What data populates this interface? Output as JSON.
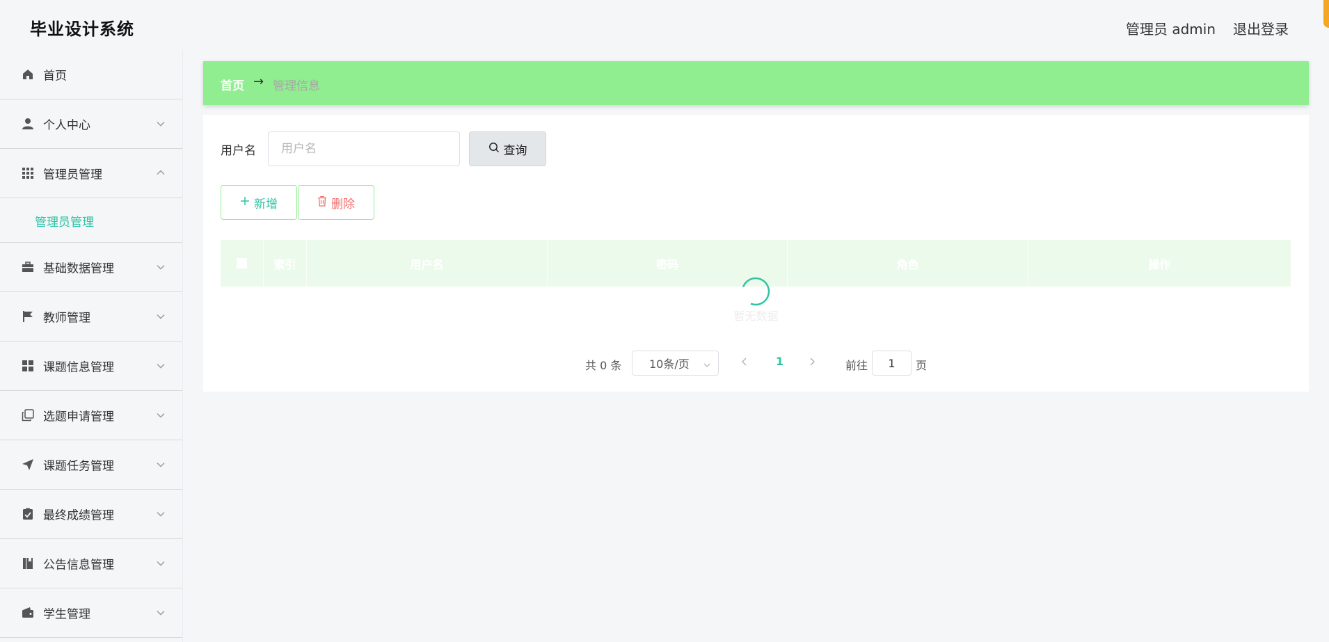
{
  "header": {
    "title": "毕业设计系统",
    "user": "管理员 admin",
    "logout": "退出登录"
  },
  "sidebar": {
    "items": [
      {
        "label": "首页",
        "icon": "home-icon"
      },
      {
        "label": "个人中心",
        "icon": "user-icon"
      },
      {
        "label": "管理员管理",
        "icon": "grid-icon",
        "expanded": true,
        "children": [
          "管理员管理"
        ]
      },
      {
        "label": "基础数据管理",
        "icon": "briefcase-icon"
      },
      {
        "label": "教师管理",
        "icon": "flag-icon"
      },
      {
        "label": "课题信息管理",
        "icon": "apps-icon"
      },
      {
        "label": "选题申请管理",
        "icon": "copy-icon"
      },
      {
        "label": "课题任务管理",
        "icon": "send-icon"
      },
      {
        "label": "最终成绩管理",
        "icon": "clipboard-check-icon"
      },
      {
        "label": "公告信息管理",
        "icon": "book-icon"
      },
      {
        "label": "学生管理",
        "icon": "wallet-icon"
      }
    ]
  },
  "breadcrumb": {
    "home": "首页",
    "arrow": "→",
    "current": "管理信息"
  },
  "search": {
    "label": "用户名",
    "placeholder": "用户名",
    "value": "",
    "button": "查询"
  },
  "actions": {
    "add": "新增",
    "delete": "删除"
  },
  "table": {
    "columns": [
      "",
      "索引",
      "用户名",
      "密码",
      "角色",
      "操作"
    ],
    "empty_text": "暂无数据"
  },
  "pagination": {
    "total": "共 0 条",
    "page_size": "10条/页",
    "current_page": "1",
    "goto_label": "前往",
    "goto_value": "1",
    "page_suffix": "页"
  },
  "colors": {
    "accent": "#2fc3a5",
    "breadcrumb_bg": "#90ee90",
    "danger": "#f56c6c",
    "header_accent": "#f5a623"
  }
}
